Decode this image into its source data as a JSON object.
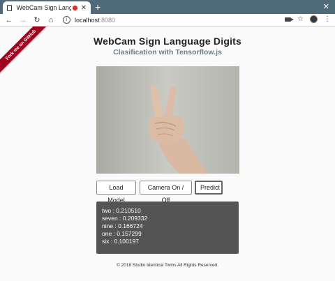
{
  "browser": {
    "tab_title": "WebCam Sign Langua",
    "url_host": "localhost",
    "url_port": ":8080"
  },
  "ribbon": {
    "label": "Fork me on GitHub"
  },
  "page": {
    "title": "WebCam Sign Language Digits",
    "subtitle": "Clasification with Tensorflow.js"
  },
  "buttons": {
    "load_model": "Load Model",
    "camera": "Camera On / Off",
    "predict": "Predict"
  },
  "results": [
    {
      "text": "two : 0.210510"
    },
    {
      "text": "seven : 0.209332"
    },
    {
      "text": "nine : 0.166724"
    },
    {
      "text": "one : 0.157299"
    },
    {
      "text": "six : 0.100197"
    }
  ],
  "footer": {
    "text": "© 2018 Studio Identical Twins All Rights Reserved."
  }
}
